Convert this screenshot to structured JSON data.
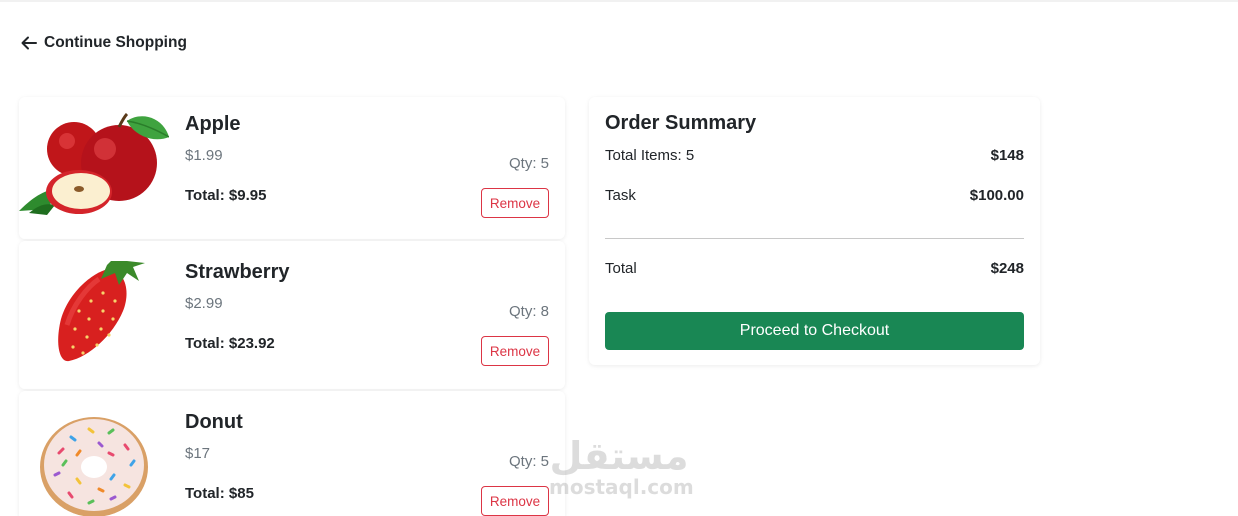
{
  "nav": {
    "back_label": "Continue Shopping",
    "back_icon": "arrow-left-icon"
  },
  "cart": {
    "items": [
      {
        "name": "Apple",
        "price": "$1.99",
        "qty": "Qty: 5",
        "total": "Total: $9.95",
        "remove_label": "Remove"
      },
      {
        "name": "Strawberry",
        "price": "$2.99",
        "qty": "Qty: 8",
        "total": "Total: $23.92",
        "remove_label": "Remove"
      },
      {
        "name": "Donut",
        "price": "$17",
        "qty": "Qty: 5",
        "total": "Total: $85",
        "remove_label": "Remove"
      }
    ]
  },
  "summary": {
    "title": "Order Summary",
    "items_label": "Total Items: 5",
    "items_value": "$148",
    "task_label": "Task",
    "task_value": "$100.00",
    "total_label": "Total",
    "total_value": "$248",
    "checkout_label": "Proceed to Checkout"
  },
  "watermark": {
    "arabic": "مستقل",
    "latin": "mostaql.com"
  },
  "colors": {
    "accent": "#198754",
    "danger": "#dc3545",
    "muted": "#6c757d",
    "text": "#212529"
  }
}
